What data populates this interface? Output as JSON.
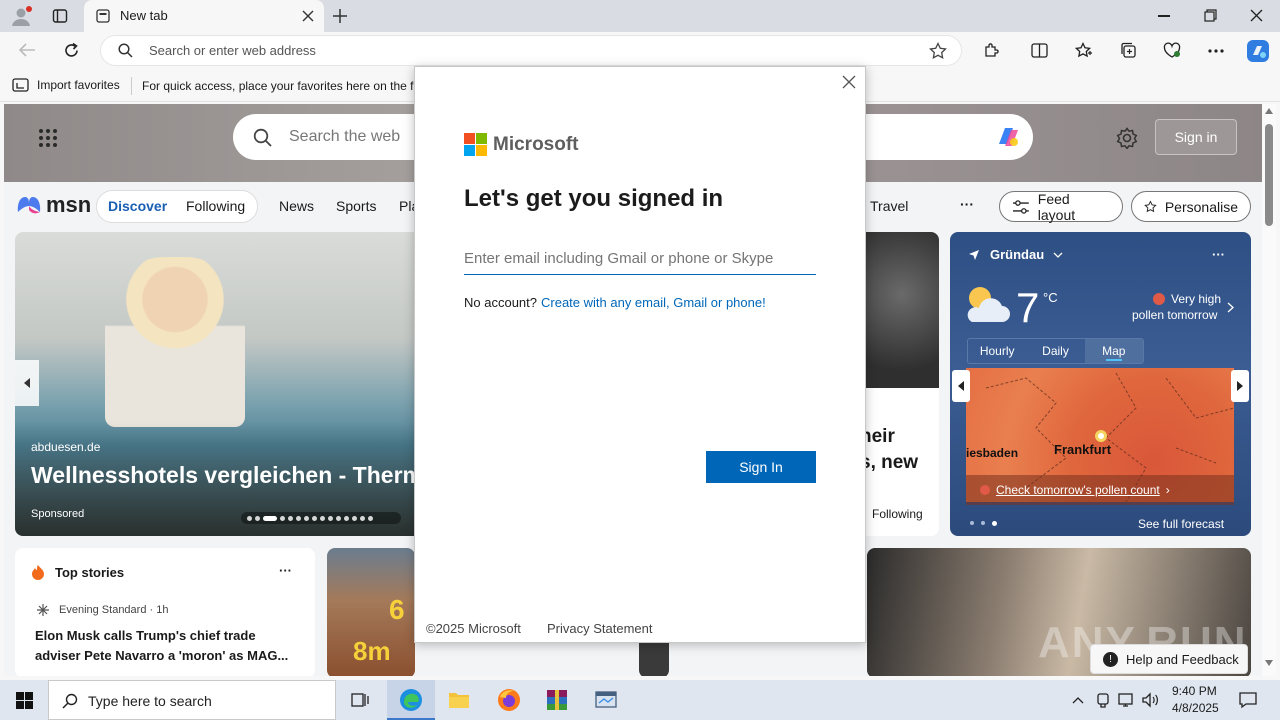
{
  "browser": {
    "tab_title": "New tab",
    "address_placeholder": "Search or enter web address",
    "favorites": {
      "import_label": "Import favorites",
      "hint": "For quick access, place your favorites here on the fa"
    }
  },
  "msn": {
    "search_placeholder": "Search the web",
    "sign_in": "Sign in",
    "logo_text": "msn",
    "nav": {
      "discover": "Discover",
      "following": "Following",
      "news": "News",
      "sports": "Sports",
      "play_partial": "Pla",
      "travel": "Travel",
      "more": "···"
    },
    "feed_layout": "Feed layout",
    "personalise": "Personalise",
    "hero": {
      "source": "abduesen.de",
      "title": "Wellnesshotels vergleichen - Therm",
      "sponsored": "Sponsored"
    },
    "partial_story": {
      "line1": "heir",
      "line2": "s, new",
      "following": "Following"
    },
    "top_stories": {
      "heading": "Top stories",
      "more": "···",
      "source": "Evening Standard · 1h",
      "headline": "Elon Musk calls Trump's chief trade adviser Pete Navarro a 'moron' as MAG..."
    },
    "solar_overlay": {
      "big": "6",
      "small": "8m"
    },
    "weather": {
      "location": "Gründau",
      "temperature": "7",
      "unit": "°C",
      "pollen_line1": "Very high",
      "pollen_line2": "pollen tomorrow",
      "tabs": [
        "Hourly",
        "Daily",
        "Map"
      ],
      "active_tab": "Map",
      "map_label_city": "Frankfurt",
      "map_label_left": "iesbaden",
      "pollen_link": "Check tomorrow's pollen count",
      "full_forecast": "See full forecast"
    },
    "help_feedback": "Help and Feedback",
    "watermark": "ANY.RUN"
  },
  "dialog": {
    "brand": "Microsoft",
    "title": "Let's get you signed in",
    "email_placeholder": "Enter email including Gmail or phone or Skype",
    "no_account": "No account?",
    "create_link": "Create with any email, Gmail or phone!",
    "sign_in_button": "Sign In",
    "copyright": "©2025 Microsoft",
    "privacy": "Privacy Statement",
    "colors": {
      "accent": "#0067b8",
      "ms_red": "#f25022",
      "ms_green": "#7fba00",
      "ms_blue": "#00a4ef",
      "ms_yellow": "#ffb900"
    }
  },
  "taskbar": {
    "search_placeholder": "Type here to search",
    "time": "9:40 PM",
    "date": "4/8/2025"
  }
}
